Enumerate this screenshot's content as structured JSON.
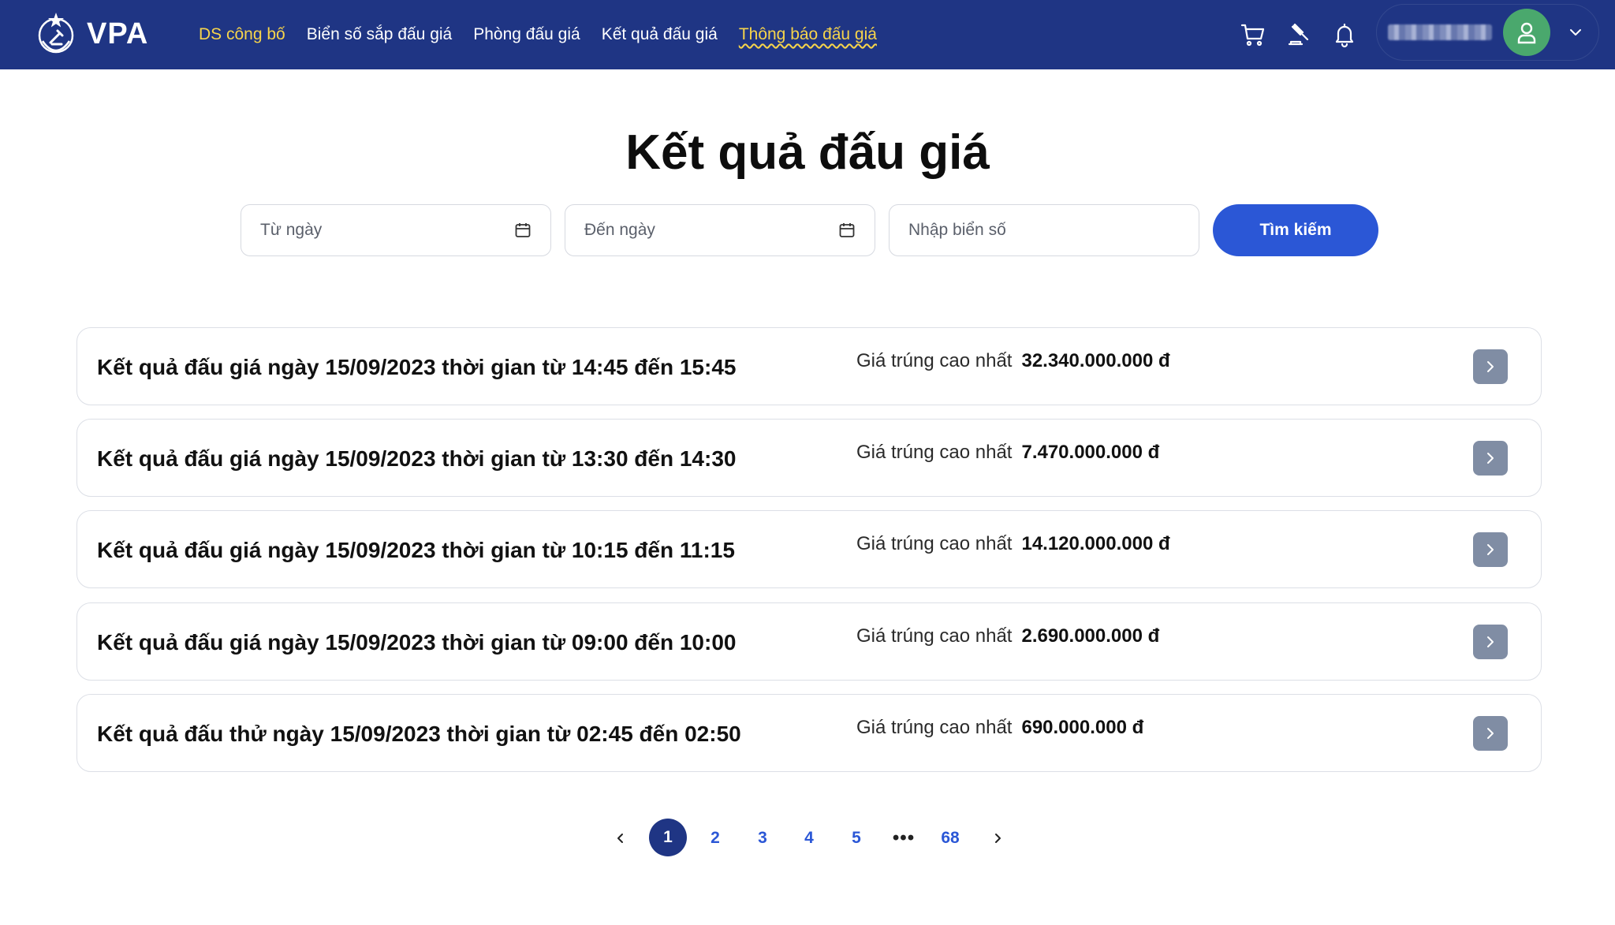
{
  "header": {
    "logo_text": "VPA",
    "nav": [
      {
        "label": "DS công bố"
      },
      {
        "label": "Biển số sắp đấu giá"
      },
      {
        "label": "Phòng đấu giá"
      },
      {
        "label": "Kết quả đấu giá"
      },
      {
        "label": "Thông báo đấu giá"
      }
    ],
    "icons": [
      "cart-icon",
      "gavel-icon",
      "bell-icon"
    ],
    "user": {
      "avatar_icon": "user-icon",
      "menu_icon": "chevron-down-icon"
    }
  },
  "page": {
    "title": "Kết quả đấu giá"
  },
  "search": {
    "from_placeholder": "Từ ngày",
    "to_placeholder": "Đến ngày",
    "plate_placeholder": "Nhập biển số",
    "button_label": "Tìm kiếm"
  },
  "results": [
    {
      "title": "Kết quả đấu giá ngày 15/09/2023 thời gian từ 14:45 đến 15:45",
      "price_label": "Giá trúng cao nhất",
      "price": "32.340.000.000 đ"
    },
    {
      "title": "Kết quả đấu giá ngày 15/09/2023 thời gian từ 13:30 đến 14:30",
      "price_label": "Giá trúng cao nhất",
      "price": "7.470.000.000 đ"
    },
    {
      "title": "Kết quả đấu giá ngày 15/09/2023 thời gian từ 10:15 đến 11:15",
      "price_label": "Giá trúng cao nhất",
      "price": "14.120.000.000 đ"
    },
    {
      "title": "Kết quả đấu giá ngày 15/09/2023 thời gian từ 09:00 đến 10:00",
      "price_label": "Giá trúng cao nhất",
      "price": "2.690.000.000 đ"
    },
    {
      "title": "Kết quả đấu thử ngày 15/09/2023 thời gian từ 02:45 đến 02:50",
      "price_label": "Giá trúng cao nhất",
      "price": "690.000.000 đ"
    }
  ],
  "pagination": {
    "prev": "<",
    "pages": [
      "1",
      "2",
      "3",
      "4",
      "5"
    ],
    "ellipsis": "•••",
    "last": "68",
    "next": ">",
    "current": "1"
  },
  "colors": {
    "header_bg": "#1f3584",
    "nav_active": "#f6d44b",
    "primary_button": "#2b57d6",
    "avatar_bg": "#4aa86d",
    "row_button": "#808da4"
  }
}
